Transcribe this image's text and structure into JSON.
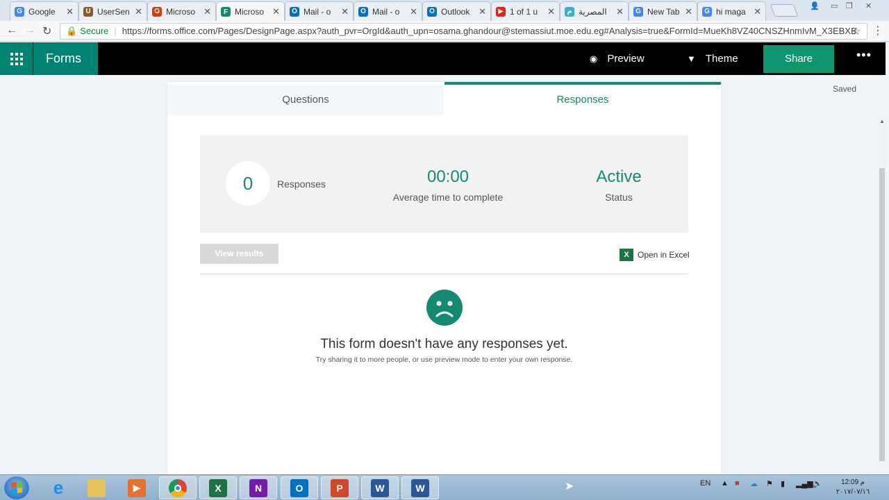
{
  "browser": {
    "tabs": [
      {
        "title": "Google",
        "icon": "google-icon",
        "color": "#4285f4",
        "glyph": "G"
      },
      {
        "title": "UserSen",
        "icon": "usersen-icon",
        "color": "#8a5a2b",
        "glyph": "U"
      },
      {
        "title": "Microso",
        "icon": "office-icon",
        "color": "#d83b01",
        "glyph": "O"
      },
      {
        "title": "Microso",
        "icon": "forms-icon",
        "color": "#138a72",
        "glyph": "F",
        "active": true
      },
      {
        "title": "Mail - o",
        "icon": "outlook-icon",
        "color": "#0072c6",
        "glyph": "O"
      },
      {
        "title": "Mail - o",
        "icon": "outlook-icon",
        "color": "#0072c6",
        "glyph": "O"
      },
      {
        "title": "Outlook",
        "icon": "outlook-icon",
        "color": "#0072c6",
        "glyph": "O"
      },
      {
        "title": "1 of 1 u",
        "icon": "youtube-icon",
        "color": "#e62117",
        "glyph": "▶"
      },
      {
        "title": "المصرية",
        "icon": "site-icon",
        "color": "#3ab0c8",
        "glyph": "م"
      },
      {
        "title": "New Tab",
        "icon": "google-icon",
        "color": "#4285f4",
        "glyph": "G"
      },
      {
        "title": "hi maga",
        "icon": "google-icon",
        "color": "#4285f4",
        "glyph": "G"
      }
    ],
    "secure_label": "Secure",
    "url": "https://forms.office.com/Pages/DesignPage.aspx?auth_pvr=OrgId&auth_upn=osama.ghandour@stemassiut.moe.edu.eg#Analysis=true&FormId=MueKh8VZ40CNSZHnmIvM_X3EBXB"
  },
  "header": {
    "app_name": "Forms",
    "preview_label": "Preview",
    "theme_label": "Theme",
    "share_label": "Share",
    "more_label": "•••"
  },
  "status": {
    "saved_label": "Saved"
  },
  "tabs": {
    "questions_label": "Questions",
    "responses_label": "Responses"
  },
  "summary": {
    "responses_count": "0",
    "responses_label": "Responses",
    "avg_time": "00:00",
    "avg_time_label": "Average time to complete",
    "status_value": "Active",
    "status_label": "Status"
  },
  "actions": {
    "view_results_label": "View results",
    "open_excel_label": "Open in Excel"
  },
  "empty": {
    "title": "This form doesn't have any responses yet.",
    "subtitle": "Try sharing it to more people, or use preview mode to enter your own response."
  },
  "taskbar": {
    "apps": [
      "ie-icon",
      "explorer-icon",
      "media-player-icon",
      "chrome-icon",
      "excel-icon",
      "onenote-icon",
      "outlook-icon",
      "powerpoint-icon",
      "word-icon",
      "word-icon"
    ],
    "language": "EN",
    "time": "12:09 م",
    "date": "٢٠١٧/٠٧/١٦"
  },
  "colors": {
    "accent": "#138a72",
    "header_bg": "#000000",
    "share_bg": "#0e9670"
  }
}
